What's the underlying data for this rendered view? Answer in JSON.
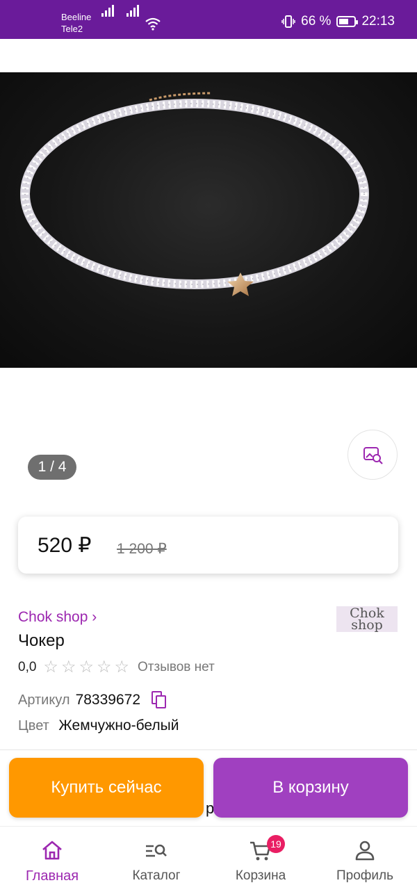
{
  "status_bar": {
    "carrier_1": "Beeline",
    "carrier_2": "Tele2",
    "battery_percent": "66 %",
    "battery_level": 0.66,
    "time": "22:13",
    "icons": [
      "signal-icon",
      "wifi-icon",
      "vibrate-icon",
      "battery-icon"
    ]
  },
  "gallery": {
    "counter": "1 / 4",
    "image_alt": "pearl bead choker with star charm",
    "search_by_photo_icon": "image-search-icon"
  },
  "price": {
    "current": "520 ₽",
    "old": "1 200 ₽"
  },
  "product": {
    "brand_link": "Chok shop ›",
    "brand_logo_line1": "Chok",
    "brand_logo_line2": "shop",
    "title": "Чокер",
    "rating_value": "0,0",
    "stars_filled": 0,
    "stars_total": 5,
    "reviews_text": "Отзывов нет",
    "sku_label": "Артикул",
    "sku_value": "78339672",
    "color_label": "Цвет",
    "color_value": "Жемчужно-белый"
  },
  "behind": {
    "fragment": "р"
  },
  "actions": {
    "buy_now": "Купить сейчас",
    "add_to_cart": "В корзину"
  },
  "bottom_nav": {
    "items": [
      {
        "label": "Главная",
        "icon": "home-icon",
        "active": true
      },
      {
        "label": "Каталог",
        "icon": "catalog-search-icon",
        "active": false
      },
      {
        "label": "Корзина",
        "icon": "cart-icon",
        "active": false,
        "badge": "19"
      },
      {
        "label": "Профиль",
        "icon": "profile-icon",
        "active": false
      }
    ]
  },
  "colors": {
    "brand_purple": "#6a1b9a",
    "accent_purple": "#9c27b0",
    "cart_button": "#a040c0",
    "buy_button": "#ff9800",
    "badge": "#e91e63"
  }
}
